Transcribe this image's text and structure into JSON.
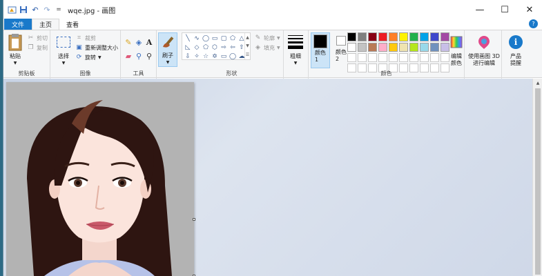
{
  "window": {
    "title": "wqe.jpg - 画图",
    "qa_dropdown": "=",
    "controls": {
      "minimize": "—",
      "maximize": "☐",
      "close": "✕"
    }
  },
  "tabs": [
    {
      "label": "文件"
    },
    {
      "label": "主页"
    },
    {
      "label": "查看"
    }
  ],
  "help": "?",
  "ribbon": {
    "clipboard": {
      "label": "剪贴板",
      "paste": "粘贴",
      "cut": "剪切",
      "copy": "复制"
    },
    "image": {
      "label": "图像",
      "select": "选择",
      "crop": "裁剪",
      "resize": "重新调整大小",
      "rotate": "旋转"
    },
    "tools": {
      "label": "工具",
      "text_tool": "A"
    },
    "brush": {
      "label": "刷子"
    },
    "shapes": {
      "label": "形状",
      "outline": "轮廓",
      "fill": "填充"
    },
    "size": {
      "label": "粗细"
    },
    "colors": {
      "label": "颜色",
      "color1": "颜色 1",
      "color2": "颜色 2",
      "edit": "编辑颜色",
      "color1_value": "#000000",
      "color2_value": "#ffffff",
      "palette": [
        "#000000",
        "#7f7f7f",
        "#880015",
        "#ed1c24",
        "#ff7f27",
        "#fff200",
        "#22b14c",
        "#00a2e8",
        "#3f48cc",
        "#a349a4",
        "#ffffff",
        "#c3c3c3",
        "#b97a57",
        "#ffaec9",
        "#ffc90e",
        "#efe4b0",
        "#b5e61d",
        "#99d9ea",
        "#7092be",
        "#c8bfe7",
        "",
        "",
        "",
        "",
        "",
        "",
        "",
        "",
        "",
        "",
        "",
        "",
        "",
        "",
        "",
        "",
        "",
        "",
        "",
        ""
      ]
    },
    "paint3d": {
      "label": "使用画图 3D 进行编辑"
    },
    "alert": {
      "label": "产品提醒",
      "icon": "i"
    }
  }
}
